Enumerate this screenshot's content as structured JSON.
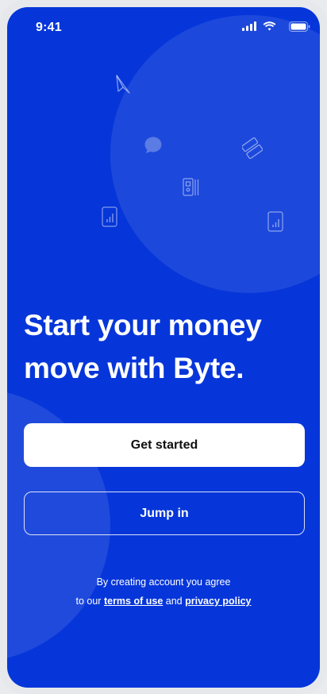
{
  "status_bar": {
    "time": "9:41",
    "icons": [
      "signal-icon",
      "wifi-icon",
      "battery-icon"
    ]
  },
  "hero": {
    "decor_icons": [
      "send-icon",
      "chat-bubble-icon",
      "card-icon",
      "receipt-icon",
      "phone-chart-icon",
      "phone-chart-icon"
    ]
  },
  "headline": "Start your money move with Byte.",
  "buttons": {
    "primary_label": "Get started",
    "secondary_label": "Jump in"
  },
  "legal": {
    "line1": "By creating account you agree",
    "prefix": "to our",
    "terms_label": "terms of use",
    "and": "and",
    "privacy_label": "privacy policy"
  },
  "colors": {
    "background": "#0636d9",
    "primary_button": "#ffffff",
    "text": "#ffffff"
  }
}
